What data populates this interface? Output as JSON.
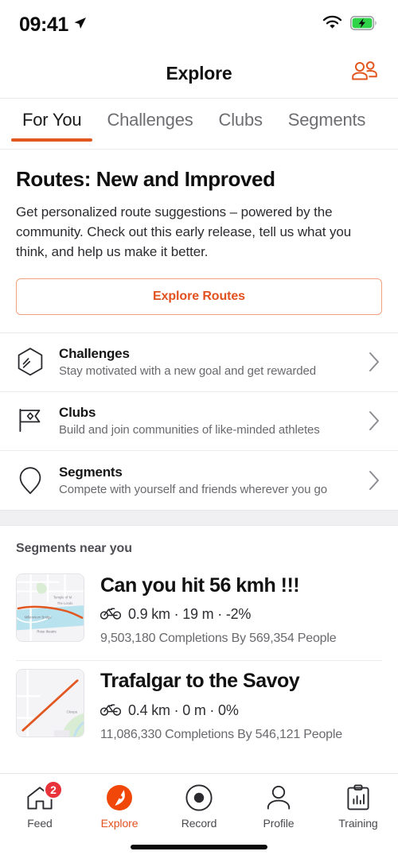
{
  "status_bar": {
    "time": "09:41",
    "location_icon": "location-arrow-icon",
    "wifi_icon": "wifi-icon",
    "battery_icon": "battery-charging-icon"
  },
  "header": {
    "title": "Explore",
    "action_icon": "group-people-icon"
  },
  "tabs": [
    {
      "label": "For You",
      "active": true
    },
    {
      "label": "Challenges",
      "active": false
    },
    {
      "label": "Clubs",
      "active": false
    },
    {
      "label": "Segments",
      "active": false
    }
  ],
  "promo": {
    "title": "Routes: New and Improved",
    "body": "Get personalized route suggestions – powered by the community. Check out this early release, tell us what you think, and help us make it better.",
    "button_label": "Explore Routes"
  },
  "nav_rows": [
    {
      "icon": "hexagon-challenge-icon",
      "title": "Challenges",
      "subtitle": "Stay motivated with a new goal and get rewarded",
      "chevron": "chevron-right-icon"
    },
    {
      "icon": "flag-club-icon",
      "title": "Clubs",
      "subtitle": "Build and join communities of like-minded athletes",
      "chevron": "chevron-right-icon"
    },
    {
      "icon": "pin-segment-icon",
      "title": "Segments",
      "subtitle": "Compete with yourself and friends wherever you go",
      "chevron": "chevron-right-icon"
    }
  ],
  "segments": {
    "heading": "Segments near you",
    "items": [
      {
        "title": "Can you hit 56 kmh !!!",
        "activity_icon": "bicycle-icon",
        "stats": "0.9 km · 19 m · -2%",
        "distance": "0.9 km",
        "elevation": "19 m",
        "grade": "-2%",
        "meta": "9,503,180 Completions By 569,354 People",
        "completions": "9,503,180",
        "people": "569,354",
        "map_labels": [
          "Temple of M",
          "The Londo",
          "Millennium Bridge",
          "Rose theatre"
        ]
      },
      {
        "title": "Trafalgar to the Savoy",
        "activity_icon": "bicycle-icon",
        "stats": "0.4 km · 0 m · 0%",
        "distance": "0.4 km",
        "elevation": "0 m",
        "grade": "0%",
        "meta": "11,086,330 Completions By 546,121 People",
        "completions": "11,086,330",
        "people": "546,121",
        "map_labels": [
          "Cleopa"
        ]
      }
    ]
  },
  "bottom_nav": [
    {
      "label": "Feed",
      "icon": "home-icon",
      "badge": "2",
      "active": false
    },
    {
      "label": "Explore",
      "icon": "compass-icon",
      "badge": "",
      "active": true
    },
    {
      "label": "Record",
      "icon": "record-circle-icon",
      "badge": "",
      "active": false
    },
    {
      "label": "Profile",
      "icon": "person-icon",
      "badge": "",
      "active": false
    },
    {
      "label": "Training",
      "icon": "clipboard-chart-icon",
      "badge": "",
      "active": false
    }
  ],
  "colors": {
    "accent_orange": "#e2511f",
    "badge_red": "#e8333a",
    "route_line": "#e2561f",
    "text_primary": "#121212",
    "text_secondary": "#69696e",
    "band_gray": "#f0f0f3"
  }
}
